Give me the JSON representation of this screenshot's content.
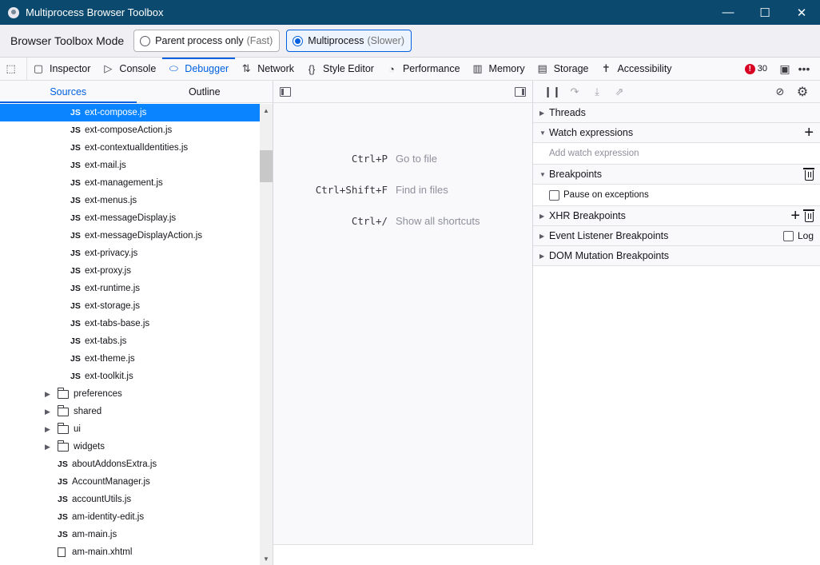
{
  "window": {
    "title": "Multiprocess Browser Toolbox",
    "minimize": "—",
    "maximize": "☐",
    "close": "✕"
  },
  "mode": {
    "label": "Browser Toolbox Mode",
    "options": [
      {
        "label": "Parent process only",
        "hint": "(Fast)",
        "selected": false
      },
      {
        "label": "Multiprocess",
        "hint": "(Slower)",
        "selected": true
      }
    ]
  },
  "tabs": [
    {
      "label": "Inspector",
      "icon": "inspector-icon",
      "glyph": "▢"
    },
    {
      "label": "Console",
      "icon": "console-icon",
      "glyph": "▷"
    },
    {
      "label": "Debugger",
      "icon": "debugger-icon",
      "glyph": "⬭"
    },
    {
      "label": "Network",
      "icon": "network-icon",
      "glyph": "⇅"
    },
    {
      "label": "Style Editor",
      "icon": "style-editor-icon",
      "glyph": "{}"
    },
    {
      "label": "Performance",
      "icon": "performance-icon",
      "glyph": "◔"
    },
    {
      "label": "Memory",
      "icon": "memory-icon",
      "glyph": "▥"
    },
    {
      "label": "Storage",
      "icon": "storage-icon",
      "glyph": "▤"
    },
    {
      "label": "Accessibility",
      "icon": "accessibility-icon",
      "glyph": "✝"
    }
  ],
  "toolbar_right": {
    "error_count": "30",
    "error_mark": "!"
  },
  "sources": {
    "tab_sources": "Sources",
    "tab_outline": "Outline",
    "tree": [
      {
        "type": "js",
        "name": "ext-compose.js",
        "selected": true
      },
      {
        "type": "js",
        "name": "ext-composeAction.js"
      },
      {
        "type": "js",
        "name": "ext-contextualIdentities.js"
      },
      {
        "type": "js",
        "name": "ext-mail.js"
      },
      {
        "type": "js",
        "name": "ext-management.js"
      },
      {
        "type": "js",
        "name": "ext-menus.js"
      },
      {
        "type": "js",
        "name": "ext-messageDisplay.js"
      },
      {
        "type": "js",
        "name": "ext-messageDisplayAction.js"
      },
      {
        "type": "js",
        "name": "ext-privacy.js"
      },
      {
        "type": "js",
        "name": "ext-proxy.js"
      },
      {
        "type": "js",
        "name": "ext-runtime.js"
      },
      {
        "type": "js",
        "name": "ext-storage.js"
      },
      {
        "type": "js",
        "name": "ext-tabs-base.js"
      },
      {
        "type": "js",
        "name": "ext-tabs.js"
      },
      {
        "type": "js",
        "name": "ext-theme.js"
      },
      {
        "type": "js",
        "name": "ext-toolkit.js"
      },
      {
        "type": "folder",
        "name": "preferences"
      },
      {
        "type": "folder",
        "name": "shared"
      },
      {
        "type": "folder",
        "name": "ui"
      },
      {
        "type": "folder",
        "name": "widgets"
      },
      {
        "type": "js2",
        "name": "aboutAddonsExtra.js"
      },
      {
        "type": "js2",
        "name": "AccountManager.js"
      },
      {
        "type": "js2",
        "name": "accountUtils.js"
      },
      {
        "type": "js2",
        "name": "am-identity-edit.js"
      },
      {
        "type": "js2",
        "name": "am-main.js"
      },
      {
        "type": "file",
        "name": "am-main.xhtml"
      }
    ],
    "js_label": "JS"
  },
  "editor": {
    "shortcuts": [
      {
        "key": "Ctrl+P",
        "desc": "Go to file"
      },
      {
        "key": "Ctrl+Shift+F",
        "desc": "Find in files"
      },
      {
        "key": "Ctrl+/",
        "desc": "Show all shortcuts"
      }
    ]
  },
  "debugger_panel": {
    "threads": "Threads",
    "watch": "Watch expressions",
    "watch_placeholder": "Add watch expression",
    "breakpoints": "Breakpoints",
    "pause_exceptions": "Pause on exceptions",
    "xhr": "XHR Breakpoints",
    "event_listener": "Event Listener Breakpoints",
    "log_label": "Log",
    "dom_mutation": "DOM Mutation Breakpoints"
  }
}
